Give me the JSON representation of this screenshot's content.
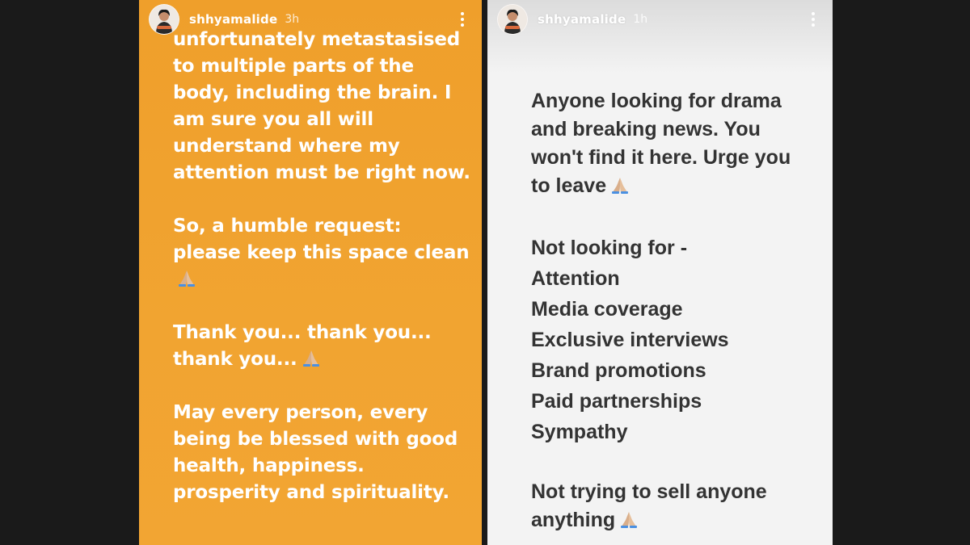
{
  "stories": [
    {
      "username": "shhyamalide",
      "timestamp": "3h",
      "bg_color": "#f0a130",
      "paragraphs": [
        {
          "text": "unfortunately metastasised to multiple parts of the body, including the brain. I am sure you all will understand where my attention must be right now.",
          "emoji": ""
        },
        {
          "text": "So, a humble request: please keep this space clean",
          "emoji": "folded-hands"
        },
        {
          "text": "Thank you... thank you... thank you...",
          "emoji": "folded-hands"
        },
        {
          "text": "May every person, every being be blessed with good health, happiness. prosperity and spirituality.",
          "emoji": ""
        }
      ]
    },
    {
      "username": "shhyamalide",
      "timestamp": "1h",
      "bg_color": "#f3f3f3",
      "intro": "Anyone looking for drama and breaking news. You won't find it here. Urge you to leave",
      "heading": "Not looking for -",
      "list": [
        "Attention",
        "Media coverage",
        "Exclusive interviews",
        "Brand promotions",
        "Paid partnerships",
        "Sympathy"
      ],
      "closing": "Not trying to sell anyone anything"
    }
  ],
  "icons": {
    "more": "more-vertical-icon",
    "emoji": "folded-hands-icon"
  }
}
